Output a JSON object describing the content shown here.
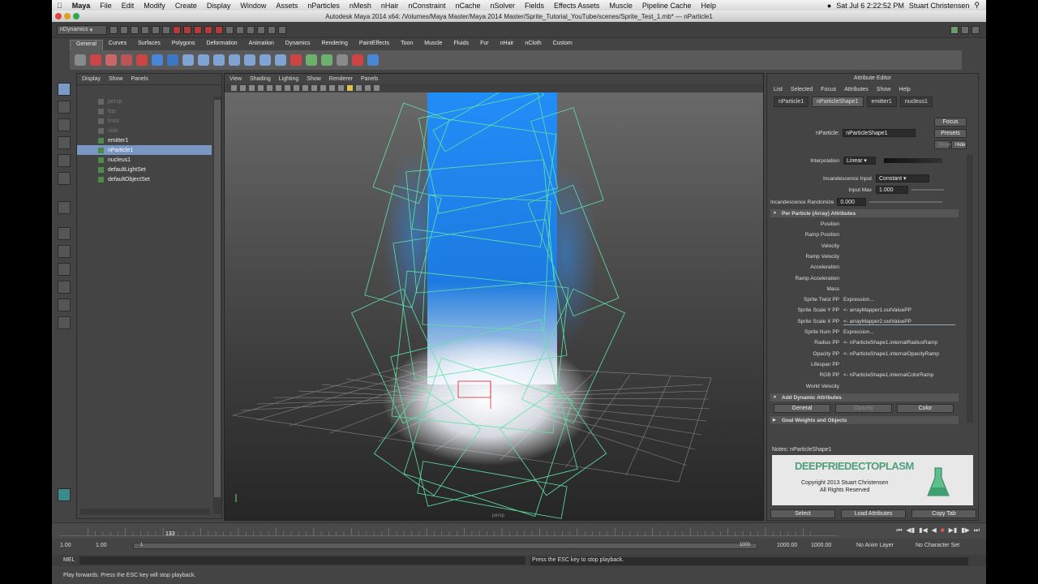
{
  "menubar": {
    "app": "Maya",
    "items": [
      "File",
      "Edit",
      "Modify",
      "Create",
      "Display",
      "Window",
      "Assets",
      "nParticles",
      "nMesh",
      "nHair",
      "nConstraint",
      "nCache",
      "nSolver",
      "Fields",
      "Effects Assets",
      "Muscle",
      "Pipeline Cache",
      "Help"
    ],
    "clock": "Sat Jul 6  2:22:52 PM",
    "user": "Stuart Christensen"
  },
  "window_title": "Autodesk Maya 2014 x64: /Volumes/Maya Master/Maya 2014 Master/Sprite_Tutorial_YouTube/scenes/Sprite_Test_1.mb*  ---  nParticle1",
  "menuset": "nDynamics",
  "shelf_tabs": [
    "General",
    "Curves",
    "Surfaces",
    "Polygons",
    "Deformation",
    "Animation",
    "Dynamics",
    "Rendering",
    "PaintEffects",
    "Toon",
    "Muscle",
    "Fluids",
    "Fur",
    "nHair",
    "nCloth",
    "Custom"
  ],
  "outliner": {
    "menu": [
      "Display",
      "Show",
      "Panels"
    ],
    "items": [
      {
        "label": "persp",
        "state": "dim"
      },
      {
        "label": "top",
        "state": "dim"
      },
      {
        "label": "front",
        "state": "dim"
      },
      {
        "label": "side",
        "state": "dim"
      },
      {
        "label": "emitter1",
        "state": "normal"
      },
      {
        "label": "nParticle1",
        "state": "selected"
      },
      {
        "label": "nucleus1",
        "state": "normal"
      },
      {
        "label": "defaultLightSet",
        "state": "normal"
      },
      {
        "label": "defaultObjectSet",
        "state": "normal"
      }
    ]
  },
  "viewport": {
    "menu": [
      "View",
      "Shading",
      "Lighting",
      "Show",
      "Renderer",
      "Panels"
    ],
    "camera_label": "persp"
  },
  "attribute_editor": {
    "title": "Attribute Editor",
    "menu": [
      "List",
      "Selected",
      "Focus",
      "Attributes",
      "Show",
      "Help"
    ],
    "tabs": [
      "nParticle1",
      "nParticleShape1",
      "emitter1",
      "nucleus1"
    ],
    "active_tab": "nParticleShape1",
    "node_label": "nParticle:",
    "node_value": "nParticleShape1",
    "buttons": {
      "focus": "Focus",
      "presets": "Presets",
      "show": "Show",
      "hide": "Hide"
    },
    "interpolation_label": "Interpolation",
    "interpolation_value": "Linear",
    "incandescence_input_label": "Incandescence Input",
    "incandescence_input_value": "Constant",
    "input_max_label": "Input Max",
    "input_max_value": "1.000",
    "randomize_label": "Incandescence Randomize",
    "randomize_value": "0.000",
    "per_particle_section": "Per Particle (Array) Attributes",
    "per_particle": [
      {
        "label": "Position",
        "value": ""
      },
      {
        "label": "Ramp Position",
        "value": ""
      },
      {
        "label": "Velocity",
        "value": ""
      },
      {
        "label": "Ramp Velocity",
        "value": ""
      },
      {
        "label": "Acceleration",
        "value": ""
      },
      {
        "label": "Ramp Acceleration",
        "value": ""
      },
      {
        "label": "Mass",
        "value": ""
      },
      {
        "label": "Sprite Twist PP",
        "value": "Expression..."
      },
      {
        "label": "Sprite Scale Y PP",
        "value": "<- arrayMapper1.outValuePP"
      },
      {
        "label": "Sprite Scale X PP",
        "value": "<- arrayMapper2.outValuePP"
      },
      {
        "label": "Sprite Num PP",
        "value": "Expression..."
      },
      {
        "label": "Radius PP",
        "value": "<- nParticleShape1.internalRadiusRamp"
      },
      {
        "label": "Opacity PP",
        "value": "<- nParticleShape1.internalOpacityRamp"
      },
      {
        "label": "Lifespan PP",
        "value": ""
      },
      {
        "label": "RGB PP",
        "value": "<- nParticleShape1.internalColorRamp"
      },
      {
        "label": "World Velocity",
        "value": ""
      }
    ],
    "dynamic_section": "Add Dynamic Attributes",
    "dynamic_buttons": [
      "General",
      "Opacity",
      "Color"
    ],
    "goal_section": "Goal Weights and Objects",
    "notes_label": "Notes:  nParticleShape1",
    "notes_logo": "DEEPFRIEDECTOPLASM",
    "notes_copyright_1": "Copyright 2013  Stuart Christensen",
    "notes_copyright_2": "All Rights Reserved",
    "bottom_buttons": [
      "Select",
      "Load Attributes",
      "Copy Tab"
    ]
  },
  "timeline": {
    "current_frame": "133",
    "start": "1.00",
    "playback_start": "1.00",
    "range_label": "1",
    "range_end_label": "1000",
    "end": "1000.00",
    "playback_end": "1000.00",
    "anim_layer": "No Anim Layer",
    "character_set": "No Character Set"
  },
  "command_line": {
    "label": "MEL",
    "result": "Press the ESC key to stop playback."
  },
  "help_line": "Play forwards. Press the ESC key will stop playback.",
  "colors": {
    "selection": "#7a97c4",
    "sprite_blue": "#1f8fff",
    "wire_green": "#5fe3a6"
  }
}
